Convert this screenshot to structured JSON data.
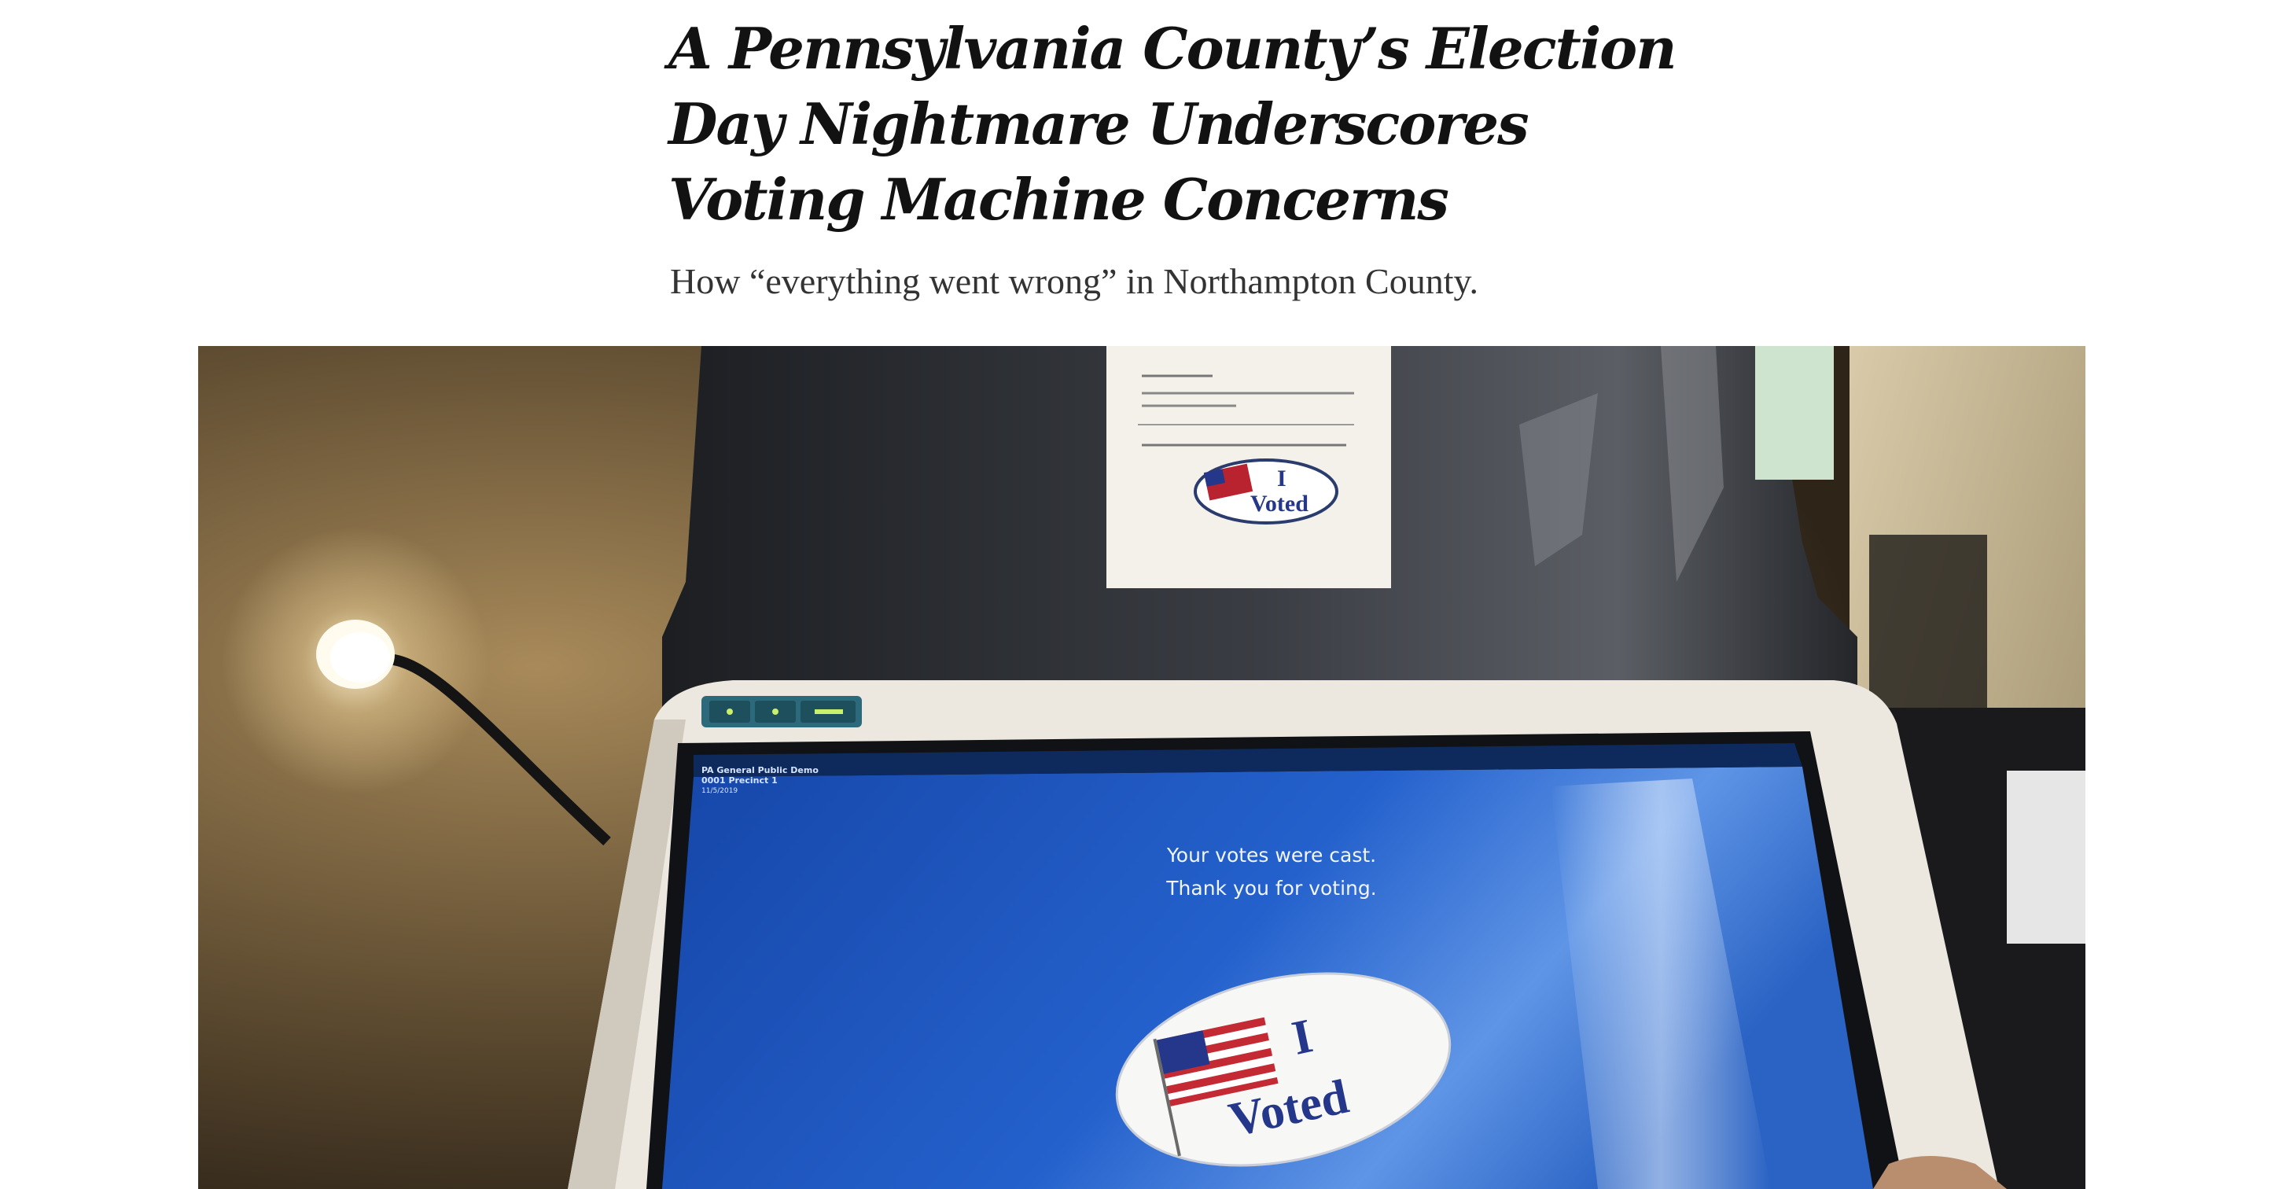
{
  "article": {
    "headline_lines": [
      "A Pennsylvania County’s Election",
      "Day Nightmare Underscores",
      "Voting Machine Concerns"
    ],
    "summary": "How “everything went wrong” in Northampton County."
  },
  "photo": {
    "screen_header": [
      "PA General Public Demo",
      "0001 Precinct 1",
      "11/5/2019"
    ],
    "screen_message": [
      "Your votes were cast.",
      "Thank you for voting."
    ],
    "sticker_text": [
      "I",
      "Voted"
    ],
    "paper_sticker_text": [
      "I",
      "Voted"
    ],
    "colors": {
      "screen_blue": "#1f5fc9",
      "wall": "#6b5638",
      "machine_white": "#e9e4dc",
      "booth_dark": "#2b2d31"
    }
  }
}
